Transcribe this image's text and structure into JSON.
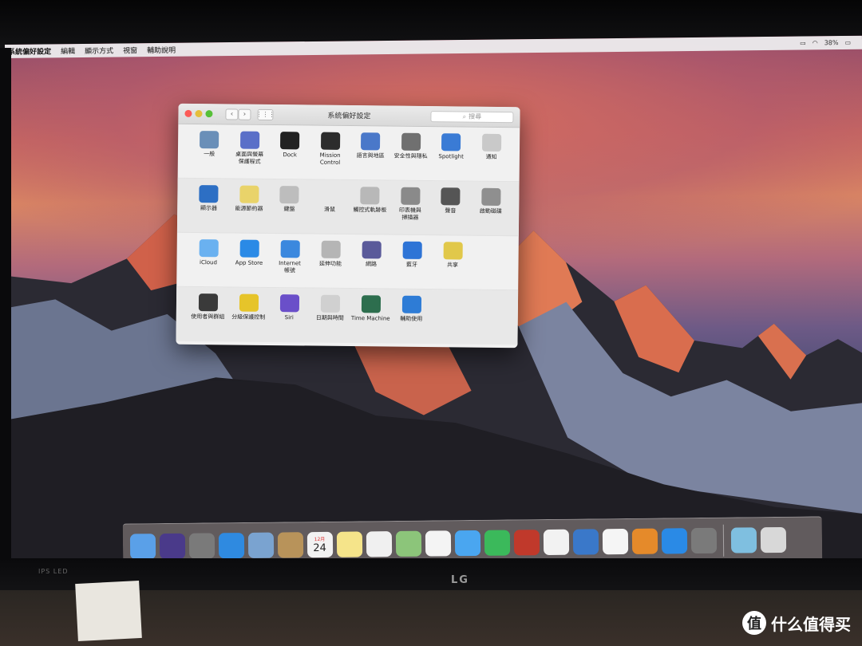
{
  "menubar": {
    "app": "系統偏好設定",
    "items": [
      "編輯",
      "顯示方式",
      "視窗",
      "輔助說明"
    ],
    "battery": "38%"
  },
  "window": {
    "title": "系統偏好設定",
    "search_placeholder": "搜尋",
    "rows": [
      [
        {
          "label": "一般",
          "icon": "general-icon",
          "color": "#6a8fb8"
        },
        {
          "label": "桌面與螢幕\n保護程式",
          "icon": "desktop-icon",
          "color": "#5a6fc8"
        },
        {
          "label": "Dock",
          "icon": "dock-icon",
          "color": "#222222"
        },
        {
          "label": "Mission\nControl",
          "icon": "mission-control-icon",
          "color": "#2c2c2c"
        },
        {
          "label": "語言與地區",
          "icon": "language-icon",
          "color": "#4a78c9"
        },
        {
          "label": "安全性與隱私",
          "icon": "security-icon",
          "color": "#707070"
        },
        {
          "label": "Spotlight",
          "icon": "spotlight-icon",
          "color": "#3a7bd5"
        },
        {
          "label": "通知",
          "icon": "notifications-icon",
          "color": "#c9c9c9"
        }
      ],
      [
        {
          "label": "顯示器",
          "icon": "display-icon",
          "color": "#2d6fc4"
        },
        {
          "label": "能源節約器",
          "icon": "energy-icon",
          "color": "#e9d36a"
        },
        {
          "label": "鍵盤",
          "icon": "keyboard-icon",
          "color": "#bdbdbd"
        },
        {
          "label": "滑鼠",
          "icon": "mouse-icon",
          "color": "#e8e8e8"
        },
        {
          "label": "觸控式軌跡板",
          "icon": "trackpad-icon",
          "color": "#b8b8b8"
        },
        {
          "label": "印表機與\n掃描器",
          "icon": "printer-icon",
          "color": "#8a8a8a"
        },
        {
          "label": "聲音",
          "icon": "sound-icon",
          "color": "#555555"
        },
        {
          "label": "啟動磁碟",
          "icon": "startup-disk-icon",
          "color": "#8f8f8f"
        }
      ],
      [
        {
          "label": "iCloud",
          "icon": "icloud-icon",
          "color": "#6ab1f0"
        },
        {
          "label": "App Store",
          "icon": "app-store-icon",
          "color": "#2a8ae6"
        },
        {
          "label": "Internet\n帳號",
          "icon": "internet-accounts-icon",
          "color": "#3b88de"
        },
        {
          "label": "延伸功能",
          "icon": "extensions-icon",
          "color": "#b5b5b5"
        },
        {
          "label": "網路",
          "icon": "network-icon",
          "color": "#5a5a9a"
        },
        {
          "label": "藍牙",
          "icon": "bluetooth-icon",
          "color": "#2e74d6"
        },
        {
          "label": "共享",
          "icon": "sharing-icon",
          "color": "#e1c84a"
        }
      ],
      [
        {
          "label": "使用者與群組",
          "icon": "users-icon",
          "color": "#3a3a3a"
        },
        {
          "label": "分級保護控制",
          "icon": "parental-controls-icon",
          "color": "#e6c42a"
        },
        {
          "label": "Siri",
          "icon": "siri-icon",
          "color": "#6a4fc9"
        },
        {
          "label": "日期與時間",
          "icon": "date-time-icon",
          "color": "#d0d0d0"
        },
        {
          "label": "Time Machine",
          "icon": "time-machine-icon",
          "color": "#2d6e4e"
        },
        {
          "label": "輔助使用",
          "icon": "accessibility-icon",
          "color": "#2e7cd6"
        }
      ]
    ]
  },
  "dock": {
    "icons": [
      {
        "name": "finder-icon",
        "color": "#5aa0e8"
      },
      {
        "name": "siri-icon",
        "color": "#4a3a8a"
      },
      {
        "name": "launchpad-icon",
        "color": "#7a7a7a"
      },
      {
        "name": "safari-icon",
        "color": "#2f8ae0"
      },
      {
        "name": "mail-icon",
        "color": "#7aa3d0"
      },
      {
        "name": "contacts-icon",
        "color": "#b8935a"
      },
      {
        "name": "calendar-icon",
        "color": "#f2f2f2"
      },
      {
        "name": "notes-icon",
        "color": "#f5e48a"
      },
      {
        "name": "reminders-icon",
        "color": "#f0f0f0"
      },
      {
        "name": "maps-icon",
        "color": "#8cc57a"
      },
      {
        "name": "photos-icon",
        "color": "#f4f4f4"
      },
      {
        "name": "messages-icon",
        "color": "#4aa6f0"
      },
      {
        "name": "facetime-icon",
        "color": "#3bb95b"
      },
      {
        "name": "photo-booth-icon",
        "color": "#c0392b"
      },
      {
        "name": "numbers-icon",
        "color": "#f2f2f2"
      },
      {
        "name": "keynote-icon",
        "color": "#3a78c9"
      },
      {
        "name": "itunes-icon",
        "color": "#f5f5f5"
      },
      {
        "name": "ibooks-icon",
        "color": "#e58a2a"
      },
      {
        "name": "app-store-icon",
        "color": "#2a8ae6"
      },
      {
        "name": "system-preferences-icon",
        "color": "#7a7a7a"
      }
    ],
    "right_icons": [
      {
        "name": "downloads-folder-icon",
        "color": "#7fbfe0"
      },
      {
        "name": "trash-icon",
        "color": "#d8d8d8"
      }
    ],
    "calendar_month": "12月",
    "calendar_day": "24"
  },
  "monitor": {
    "brand_text": "IPS LED",
    "logo": "LG"
  },
  "watermark": {
    "text": "什么值得买",
    "symbol": "值"
  }
}
